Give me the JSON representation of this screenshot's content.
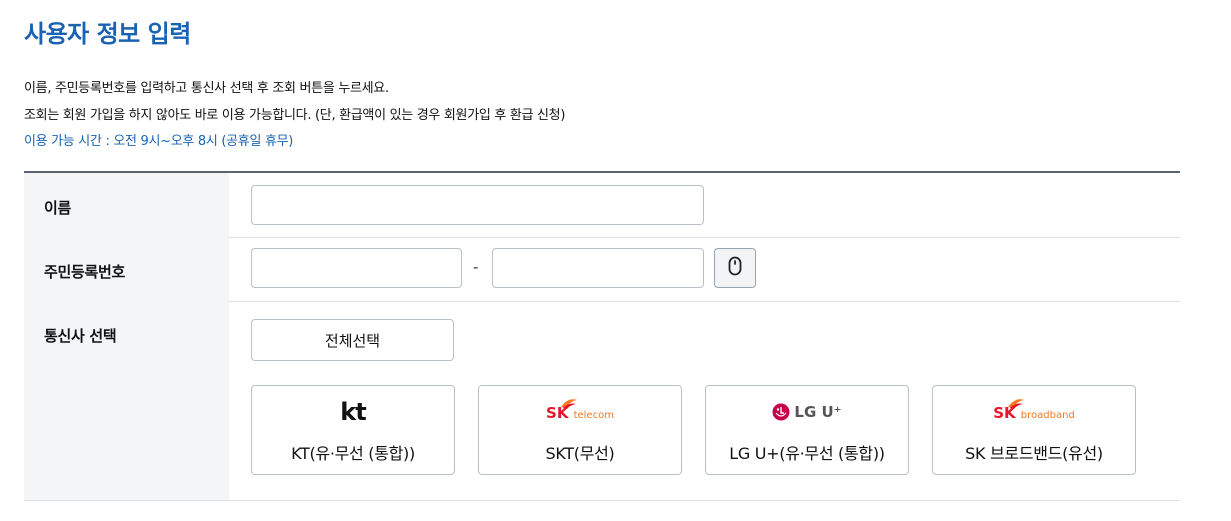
{
  "page_title": "사용자 정보 입력",
  "instructions": [
    "이름, 주민등록번호를 입력하고 통신사 선택 후 조회 버튼을 누르세요.",
    "조회는 회원 가입을 하지 않아도 바로 이용 가능합니다. (단, 환급액이 있는 경우 회원가입 후 환급 신청)"
  ],
  "service_hours": "이용 가능 시간 : 오전 9시~오후 8시 (공휴일 휴무)",
  "form": {
    "name_label": "이름",
    "name_value": "",
    "rrn_label": "주민등록번호",
    "rrn_front_value": "",
    "rrn_separator": "-",
    "rrn_back_value": "",
    "carrier_label": "통신사 선택",
    "select_all_label": "전체선택"
  },
  "carriers": [
    {
      "name": "KT(유·무선 (통합))",
      "logo_text": "kt"
    },
    {
      "name": "SKT(무선)",
      "logo_brand": "SK",
      "logo_sub": "telecom"
    },
    {
      "name": "LG U+(유·무선 (통합))",
      "logo_text": "LG U⁺"
    },
    {
      "name": "SK 브로드밴드(유선)",
      "logo_brand": "SK",
      "logo_sub": "broadband"
    }
  ],
  "colors": {
    "accent": "#1a63b4",
    "sk_red": "#e8152c",
    "sk_orange": "#f47920",
    "lg_red": "#c6004b"
  },
  "icons": {
    "keypad": "mouse-icon"
  }
}
